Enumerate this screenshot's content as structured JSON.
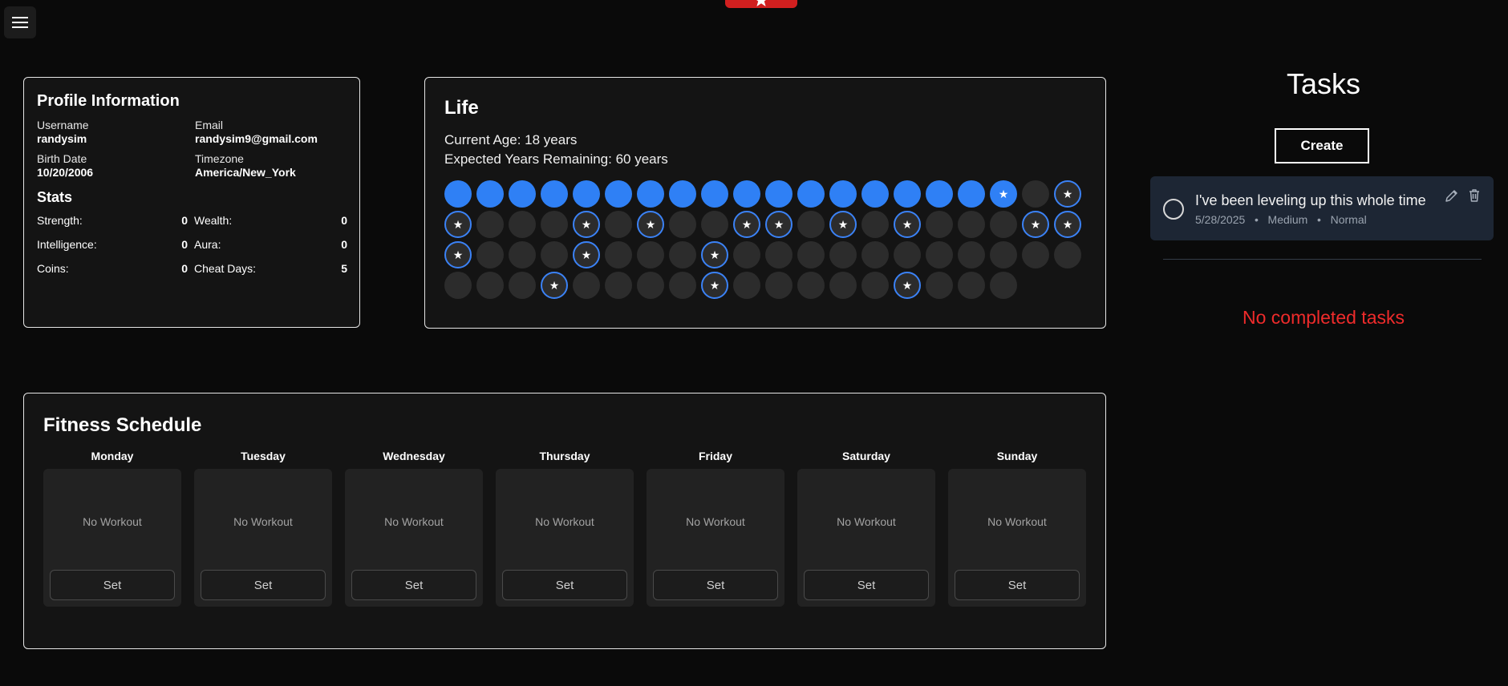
{
  "profile": {
    "title": "Profile Information",
    "username_label": "Username",
    "username": "randysim",
    "email_label": "Email",
    "email": "randysim9@gmail.com",
    "birth_label": "Birth Date",
    "birth_date": "10/20/2006",
    "timezone_label": "Timezone",
    "timezone": "America/New_York",
    "stats_title": "Stats",
    "stats": [
      {
        "label": "Strength:",
        "value": "0"
      },
      {
        "label": "Wealth:",
        "value": "0"
      },
      {
        "label": "Intelligence:",
        "value": "0"
      },
      {
        "label": "Aura:",
        "value": "0"
      },
      {
        "label": "Coins:",
        "value": "0"
      },
      {
        "label": "Cheat Days:",
        "value": "5"
      }
    ]
  },
  "life": {
    "title": "Life",
    "current_age": "Current Age: 18 years",
    "expected_remaining": "Expected Years Remaining: 60 years",
    "years_lived": 18,
    "total_years": 78,
    "starred_years": [
      18,
      20,
      21,
      25,
      27,
      30,
      31,
      33,
      35,
      39,
      40,
      41,
      45,
      49,
      64,
      69,
      75
    ]
  },
  "tasks": {
    "title": "Tasks",
    "create_label": "Create",
    "items": [
      {
        "title": "I've been leveling up this whole time",
        "date": "5/28/2025",
        "difficulty": "Medium",
        "priority": "Normal"
      }
    ],
    "meta_separator": "•",
    "no_completed": "No completed tasks"
  },
  "fitness": {
    "title": "Fitness Schedule",
    "days": [
      {
        "name": "Monday",
        "status": "No Workout",
        "button": "Set"
      },
      {
        "name": "Tuesday",
        "status": "No Workout",
        "button": "Set"
      },
      {
        "name": "Wednesday",
        "status": "No Workout",
        "button": "Set"
      },
      {
        "name": "Thursday",
        "status": "No Workout",
        "button": "Set"
      },
      {
        "name": "Friday",
        "status": "No Workout",
        "button": "Set"
      },
      {
        "name": "Saturday",
        "status": "No Workout",
        "button": "Set"
      },
      {
        "name": "Sunday",
        "status": "No Workout",
        "button": "Set"
      }
    ]
  },
  "icons": {
    "menu": "hamburger-menu-icon",
    "top_tab": "star-icon",
    "edit": "pencil-icon",
    "delete": "trash-icon",
    "radio": "circle-outline-icon"
  },
  "colors": {
    "accent_blue": "#2f80f5",
    "danger_red": "#ef2b2b",
    "tab_red": "#d11f1f",
    "panel_bg": "#141414",
    "page_bg": "#0a0a0a"
  }
}
